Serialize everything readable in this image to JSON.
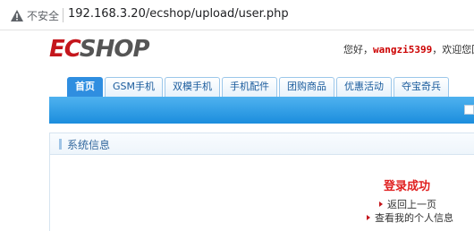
{
  "browser": {
    "security_label": "不安全",
    "url": "192.168.3.20/ecshop/upload/user.php"
  },
  "header": {
    "logo_ec": "EC",
    "logo_shop": "SHOP",
    "welcome_prefix": "您好，",
    "username": "wangzi5399",
    "welcome_suffix": "，欢迎您回"
  },
  "nav": {
    "tabs": [
      {
        "label": "首页"
      },
      {
        "label": "GSM手机"
      },
      {
        "label": "双模手机"
      },
      {
        "label": "手机配件"
      },
      {
        "label": "团购商品"
      },
      {
        "label": "优惠活动"
      },
      {
        "label": "夺宝奇兵"
      }
    ]
  },
  "panel": {
    "title": "系统信息",
    "message": "登录成功",
    "links": [
      {
        "label": "返回上一页"
      },
      {
        "label": "查看我的个人信息"
      }
    ]
  },
  "colors": {
    "accent": "#1b8ddd",
    "brand_red": "#c4161c",
    "success_red": "#e02020"
  }
}
